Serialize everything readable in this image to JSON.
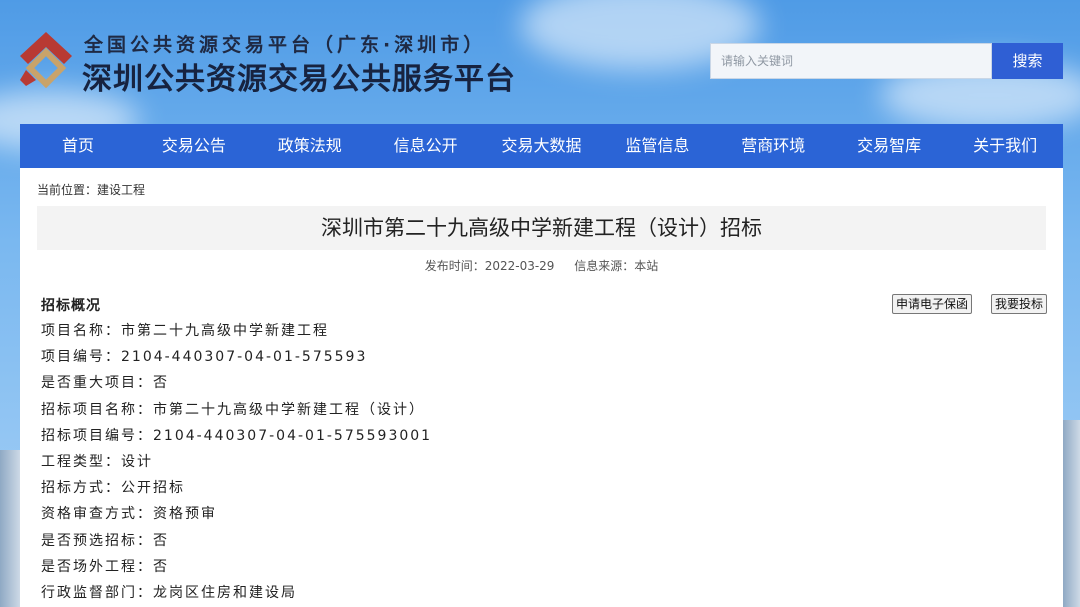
{
  "header": {
    "site_subtitle": "全国公共资源交易平台（广东·深圳市）",
    "site_title": "深圳公共资源交易公共服务平台",
    "search": {
      "placeholder": "请输入关键词",
      "button_label": "搜索"
    }
  },
  "nav": [
    "首页",
    "交易公告",
    "政策法规",
    "信息公开",
    "交易大数据",
    "监管信息",
    "营商环境",
    "交易智库",
    "关于我们"
  ],
  "breadcrumb": "当前位置：建设工程",
  "article": {
    "title": "深圳市第二十九高级中学新建工程（设计）招标",
    "publish_time": "发布时间：2022-03-29",
    "source": "信息来源：本站",
    "section_title": "招标概况",
    "buttons": {
      "guarantee": "申请电子保函",
      "bid": "我要投标"
    },
    "details": [
      "项目名称：市第二十九高级中学新建工程",
      "项目编号：2104-440307-04-01-575593",
      "是否重大项目：否",
      "招标项目名称：市第二十九高级中学新建工程（设计）",
      "招标项目编号：2104-440307-04-01-575593001",
      "工程类型：设计",
      "招标方式：公开招标",
      "资格审查方式：资格预审",
      "是否预选招标：否",
      "是否场外工程：否",
      "行政监督部门：龙岗区住房和建设局"
    ]
  },
  "colors": {
    "nav_bg": "#2b64d6",
    "search_button": "#2f5fd4",
    "logo_red": "#b83a33",
    "logo_gold": "#c9a36a"
  }
}
